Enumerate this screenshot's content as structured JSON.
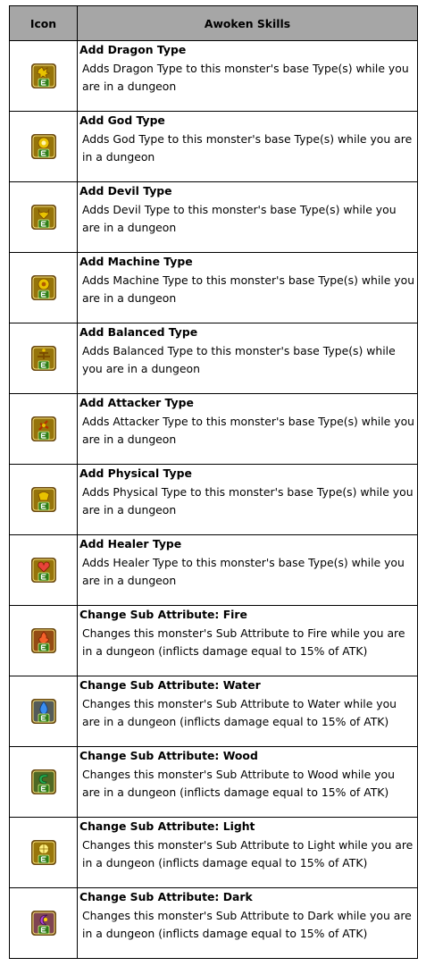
{
  "table": {
    "header": {
      "icon": "Icon",
      "skills": "Awoken Skills"
    },
    "rows": [
      {
        "icon": "dragon-type-icon",
        "color": "#e8c300",
        "glyph": "dragon",
        "title": "Add Dragon Type",
        "desc": "Adds Dragon Type to this monster's base Type(s) while you are in a dungeon"
      },
      {
        "icon": "god-type-icon",
        "color": "#e8c300",
        "glyph": "god",
        "title": "Add God Type",
        "desc": "Adds God Type to this monster's base Type(s) while you are in a dungeon"
      },
      {
        "icon": "devil-type-icon",
        "color": "#e8c300",
        "glyph": "devil",
        "title": "Add Devil Type",
        "desc": "Adds Devil Type to this monster's base Type(s) while you are in a dungeon"
      },
      {
        "icon": "machine-type-icon",
        "color": "#e8c300",
        "glyph": "machine",
        "title": "Add Machine Type",
        "desc": "Adds Machine Type to this monster's base Type(s) while you are in a dungeon"
      },
      {
        "icon": "balanced-type-icon",
        "color": "#e8c300",
        "glyph": "balanced",
        "title": "Add Balanced Type",
        "desc": "Adds Balanced Type to this monster's base Type(s) while you are in a dungeon"
      },
      {
        "icon": "attacker-type-icon",
        "color": "#e8c300",
        "glyph": "attacker",
        "title": "Add Attacker Type",
        "desc": "Adds Attacker Type to this monster's base Type(s) while you are in a dungeon"
      },
      {
        "icon": "physical-type-icon",
        "color": "#e8c300",
        "glyph": "physical",
        "title": "Add Physical Type",
        "desc": "Adds Physical Type to this monster's base Type(s) while you are in a dungeon"
      },
      {
        "icon": "healer-type-icon",
        "color": "#e8c300",
        "glyph": "healer",
        "title": "Add Healer Type",
        "desc": "Adds Healer Type to this monster's base Type(s) while you are in a dungeon"
      },
      {
        "icon": "fire-attribute-icon",
        "color": "#e14f1a",
        "glyph": "fire",
        "title": "Change Sub Attribute: Fire",
        "desc": "Changes this monster's Sub Attribute to Fire while you are in a dungeon (inflicts damage equal to 15% of ATK)"
      },
      {
        "icon": "water-attribute-icon",
        "color": "#2f7fe0",
        "glyph": "water",
        "title": "Change Sub Attribute: Water",
        "desc": "Changes this monster's Sub Attribute to Water while you are in a dungeon (inflicts damage equal to 15% of ATK)"
      },
      {
        "icon": "wood-attribute-icon",
        "color": "#1fa34a",
        "glyph": "wood",
        "title": "Change Sub Attribute: Wood",
        "desc": "Changes this monster's Sub Attribute to Wood while you are in a dungeon (inflicts damage equal to 15% of ATK)"
      },
      {
        "icon": "light-attribute-icon",
        "color": "#f2c800",
        "glyph": "light",
        "title": "Change Sub Attribute: Light",
        "desc": "Changes this monster's Sub Attribute to Light while you are in a dungeon (inflicts damage equal to 15% of ATK)"
      },
      {
        "icon": "dark-attribute-icon",
        "color": "#a83cc8",
        "glyph": "dark",
        "title": "Change Sub Attribute: Dark",
        "desc": "Changes this monster's Sub Attribute to Dark while you are in a dungeon (inflicts damage equal to 15% of ATK)"
      }
    ]
  }
}
